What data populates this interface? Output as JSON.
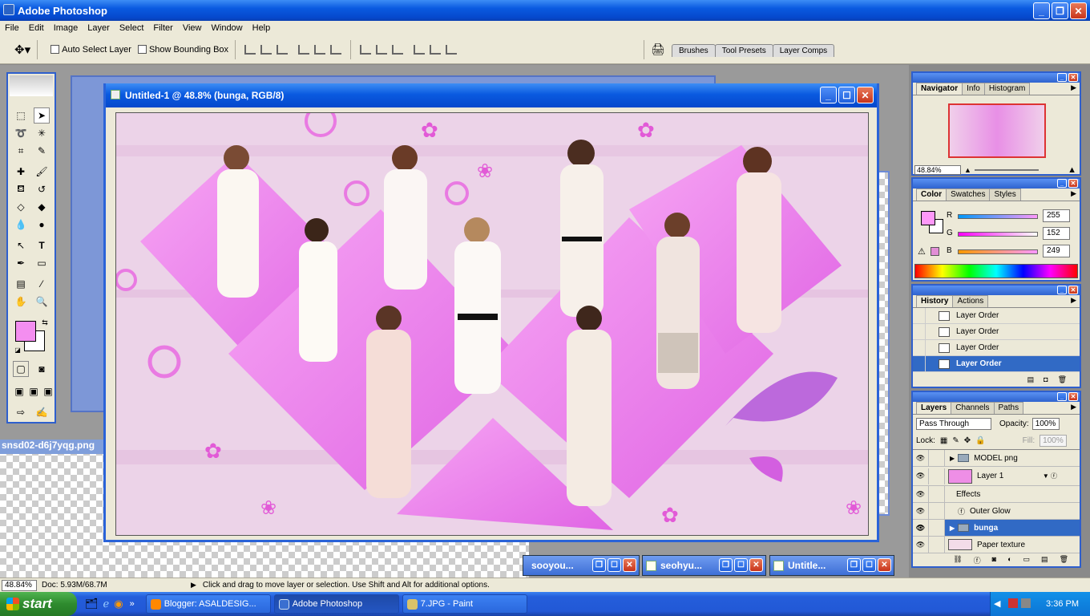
{
  "app": {
    "title": "Adobe Photoshop"
  },
  "menu": [
    "File",
    "Edit",
    "Image",
    "Layer",
    "Select",
    "Filter",
    "View",
    "Window",
    "Help"
  ],
  "options": {
    "auto_select_layer": "Auto Select Layer",
    "show_bounding_box": "Show Bounding Box",
    "palette_well": [
      "Brushes",
      "Tool Presets",
      "Layer Comps"
    ]
  },
  "document": {
    "title": "Untitled-1 @ 48.8% (bunga, RGB/8)",
    "behind_filename": "snsd02-d6j7yqg.png"
  },
  "minimized_docs": [
    "sooyou...",
    "seohyu...",
    "Untitle..."
  ],
  "status": {
    "zoom": "48.84%",
    "doc": "Doc: 5.93M/68.7M",
    "hint": "Click and drag to move layer or selection.  Use Shift and Alt for additional options."
  },
  "navigator": {
    "tabs": [
      "Navigator",
      "Info",
      "Histogram"
    ],
    "zoom": "48.84%"
  },
  "color": {
    "tabs": [
      "Color",
      "Swatches",
      "Styles"
    ],
    "channels": [
      {
        "label": "R",
        "value": "255"
      },
      {
        "label": "G",
        "value": "152"
      },
      {
        "label": "B",
        "value": "249"
      }
    ],
    "foreground": "#ff98f9",
    "background": "#ffffff"
  },
  "history": {
    "tabs": [
      "History",
      "Actions"
    ],
    "items": [
      "Layer Order",
      "Layer Order",
      "Layer Order",
      "Layer Order"
    ],
    "selected_index": 3
  },
  "layers": {
    "tabs": [
      "Layers",
      "Channels",
      "Paths"
    ],
    "blend_mode": "Pass Through",
    "opacity_label": "Opacity:",
    "opacity": "100%",
    "lock_label": "Lock:",
    "fill_label": "Fill:",
    "fill": "100%",
    "items": [
      {
        "name": "MODEL png",
        "kind": "group"
      },
      {
        "name": "Layer 1",
        "kind": "layer"
      },
      {
        "name": "Effects",
        "kind": "effects"
      },
      {
        "name": "Outer Glow",
        "kind": "effect"
      },
      {
        "name": "bunga",
        "kind": "group",
        "selected": true
      },
      {
        "name": "Paper texture",
        "kind": "layer"
      }
    ]
  },
  "taskbar": {
    "start": "start",
    "tasks": [
      {
        "label": "Blogger: ASALDESIG...",
        "active": false
      },
      {
        "label": "Adobe Photoshop",
        "active": true
      },
      {
        "label": "7.JPG - Paint",
        "active": false
      }
    ],
    "clock": "3:36 PM"
  },
  "colors": {
    "xp_blue": "#0a5ae0",
    "accent_pink": "#ee66ee",
    "selection": "#316ac5"
  }
}
